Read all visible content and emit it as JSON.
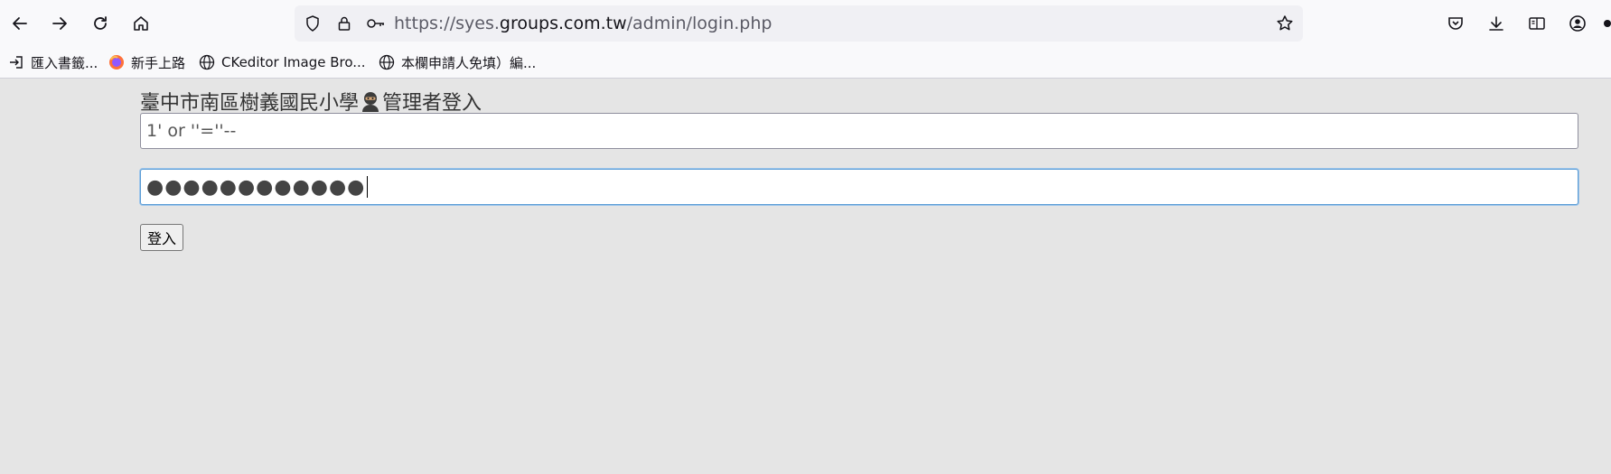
{
  "browser": {
    "url_scheme": "https://syes.",
    "url_host": "groups.com.tw",
    "url_path": "/admin/login.php",
    "bookmarks": [
      {
        "label": "匯入書籤...",
        "icon": "import-icon"
      },
      {
        "label": "新手上路",
        "icon": "firefox-icon"
      },
      {
        "label": "CKeditor Image Bro...",
        "icon": "globe-icon"
      },
      {
        "label": "本欄申請人免填）編...",
        "icon": "globe-icon"
      }
    ]
  },
  "page": {
    "title_prefix": "臺中市南區樹義國民小學",
    "title_suffix": "管理者登入",
    "title_icon": "ninja-icon",
    "username_value": "1' or ''=''--",
    "password_mask": "●●●●●●●●●●●●",
    "login_label": "登入"
  },
  "colors": {
    "page_bg": "#e5e5e5",
    "focus_border": "#5e9ed6"
  }
}
